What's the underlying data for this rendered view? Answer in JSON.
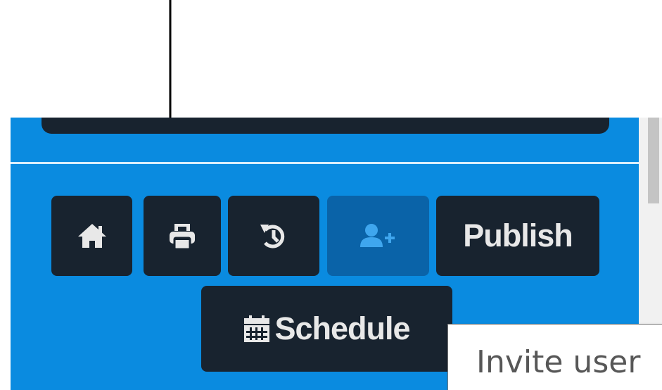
{
  "toolbar": {
    "home_icon": "home-icon",
    "print_icon": "print-icon",
    "history_icon": "history-icon",
    "invite_icon": "user-plus-icon",
    "publish_label": "Publish",
    "schedule_icon": "calendar-icon",
    "schedule_label": "Schedule"
  },
  "tooltip": {
    "text": "Invite user"
  },
  "colors": {
    "panel_blue": "#0a8be0",
    "button_dark": "#18232f",
    "button_active": "#0a63a8",
    "icon_light": "#e8e8e8",
    "invite_icon_blue": "#3fa6ee"
  }
}
